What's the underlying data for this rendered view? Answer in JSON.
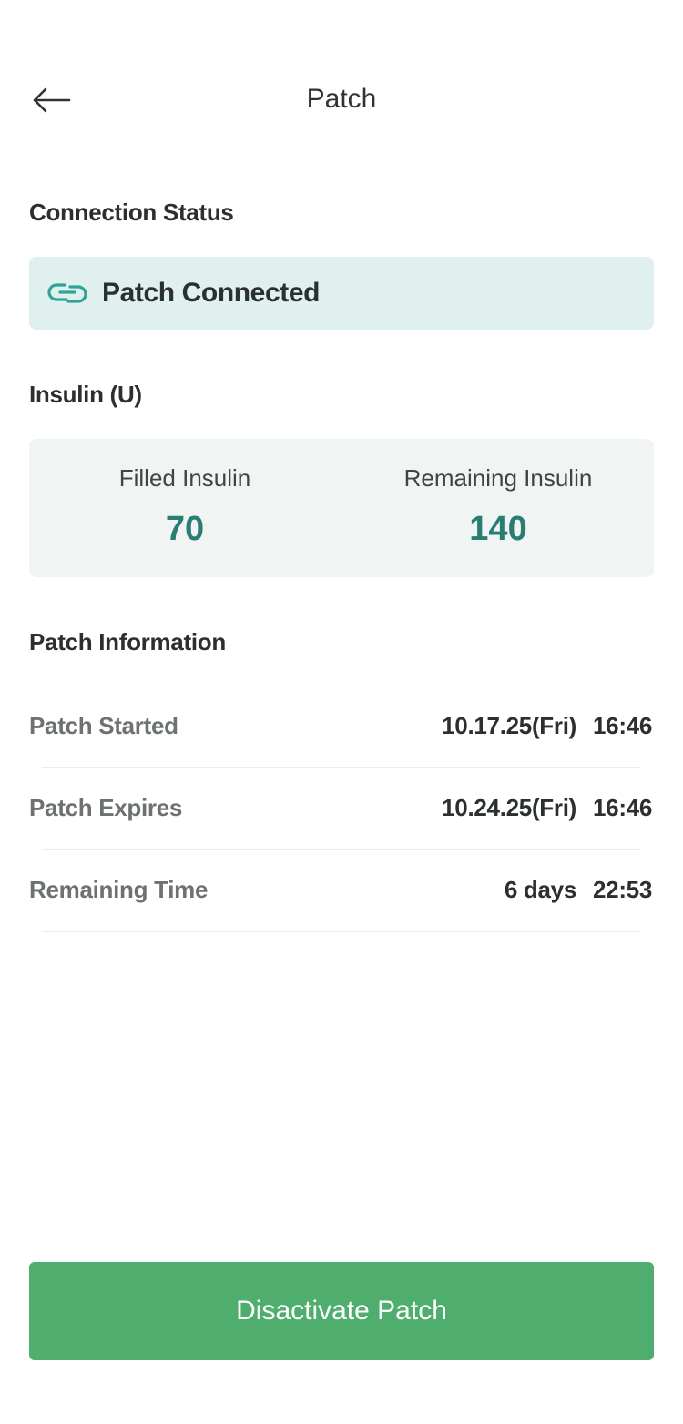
{
  "header": {
    "title": "Patch",
    "back_icon": "arrow-left-icon"
  },
  "connection": {
    "section_title": "Connection Status",
    "status_text": "Patch Connected",
    "status_icon": "link-icon",
    "accent_color": "#2fa597",
    "background_color": "#dff0ee"
  },
  "insulin": {
    "section_title": "Insulin (U)",
    "filled_label": "Filled Insulin",
    "filled_value": "70",
    "remaining_label": "Remaining Insulin",
    "remaining_value": "140",
    "value_color": "#2a7d72"
  },
  "patch_info": {
    "section_title": "Patch Information",
    "rows": [
      {
        "label": "Patch Started",
        "date": "10.17.25(Fri)",
        "time": "16:46"
      },
      {
        "label": "Patch Expires",
        "date": "10.24.25(Fri)",
        "time": "16:46"
      },
      {
        "label": "Remaining Time",
        "date": "6 days",
        "time": "22:53"
      }
    ]
  },
  "actions": {
    "disactivate_label": "Disactivate Patch",
    "button_color": "#4fae6d"
  }
}
